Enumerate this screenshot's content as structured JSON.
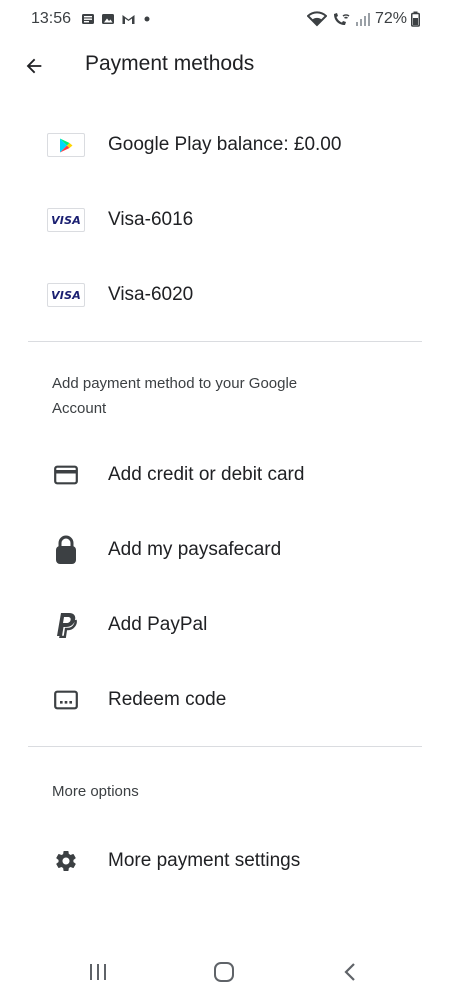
{
  "status_bar": {
    "time": "13:56",
    "battery": "72%",
    "left_icons": [
      "news-icon",
      "gallery-icon",
      "gmail-icon",
      "dot-icon"
    ],
    "right_icons": [
      "wifi-icon",
      "wifi-call-icon",
      "signal-icon",
      "battery-icon"
    ]
  },
  "header": {
    "title": "Payment methods",
    "back_icon": "arrow-back-icon"
  },
  "payment_methods": [
    {
      "label": "Google Play balance: £0.00",
      "icon": "google-play-icon"
    },
    {
      "label": "Visa-6016",
      "icon": "visa-icon",
      "badge_text": "VISA"
    },
    {
      "label": "Visa-6020",
      "icon": "visa-icon",
      "badge_text": "VISA"
    }
  ],
  "add_section": {
    "header_line1": "Add payment method to your Google",
    "header_line2": "Account",
    "items": [
      {
        "label": "Add credit or debit card",
        "icon": "credit-card-icon"
      },
      {
        "label": "Add my paysafecard",
        "icon": "paysafecard-lock-icon"
      },
      {
        "label": "Add PayPal",
        "icon": "paypal-icon"
      },
      {
        "label": "Redeem code",
        "icon": "redeem-code-icon"
      }
    ]
  },
  "more_section": {
    "header": "More options",
    "items": [
      {
        "label": "More payment settings",
        "icon": "gear-icon"
      }
    ]
  },
  "nav_bar": {
    "buttons": [
      "recents-icon",
      "home-icon",
      "back-icon"
    ]
  },
  "colors": {
    "text_primary": "#202124",
    "text_secondary": "#3c4043",
    "divider": "#dadce0",
    "visa_blue": "#1a1f71",
    "icon_dark": "#3c4043"
  }
}
